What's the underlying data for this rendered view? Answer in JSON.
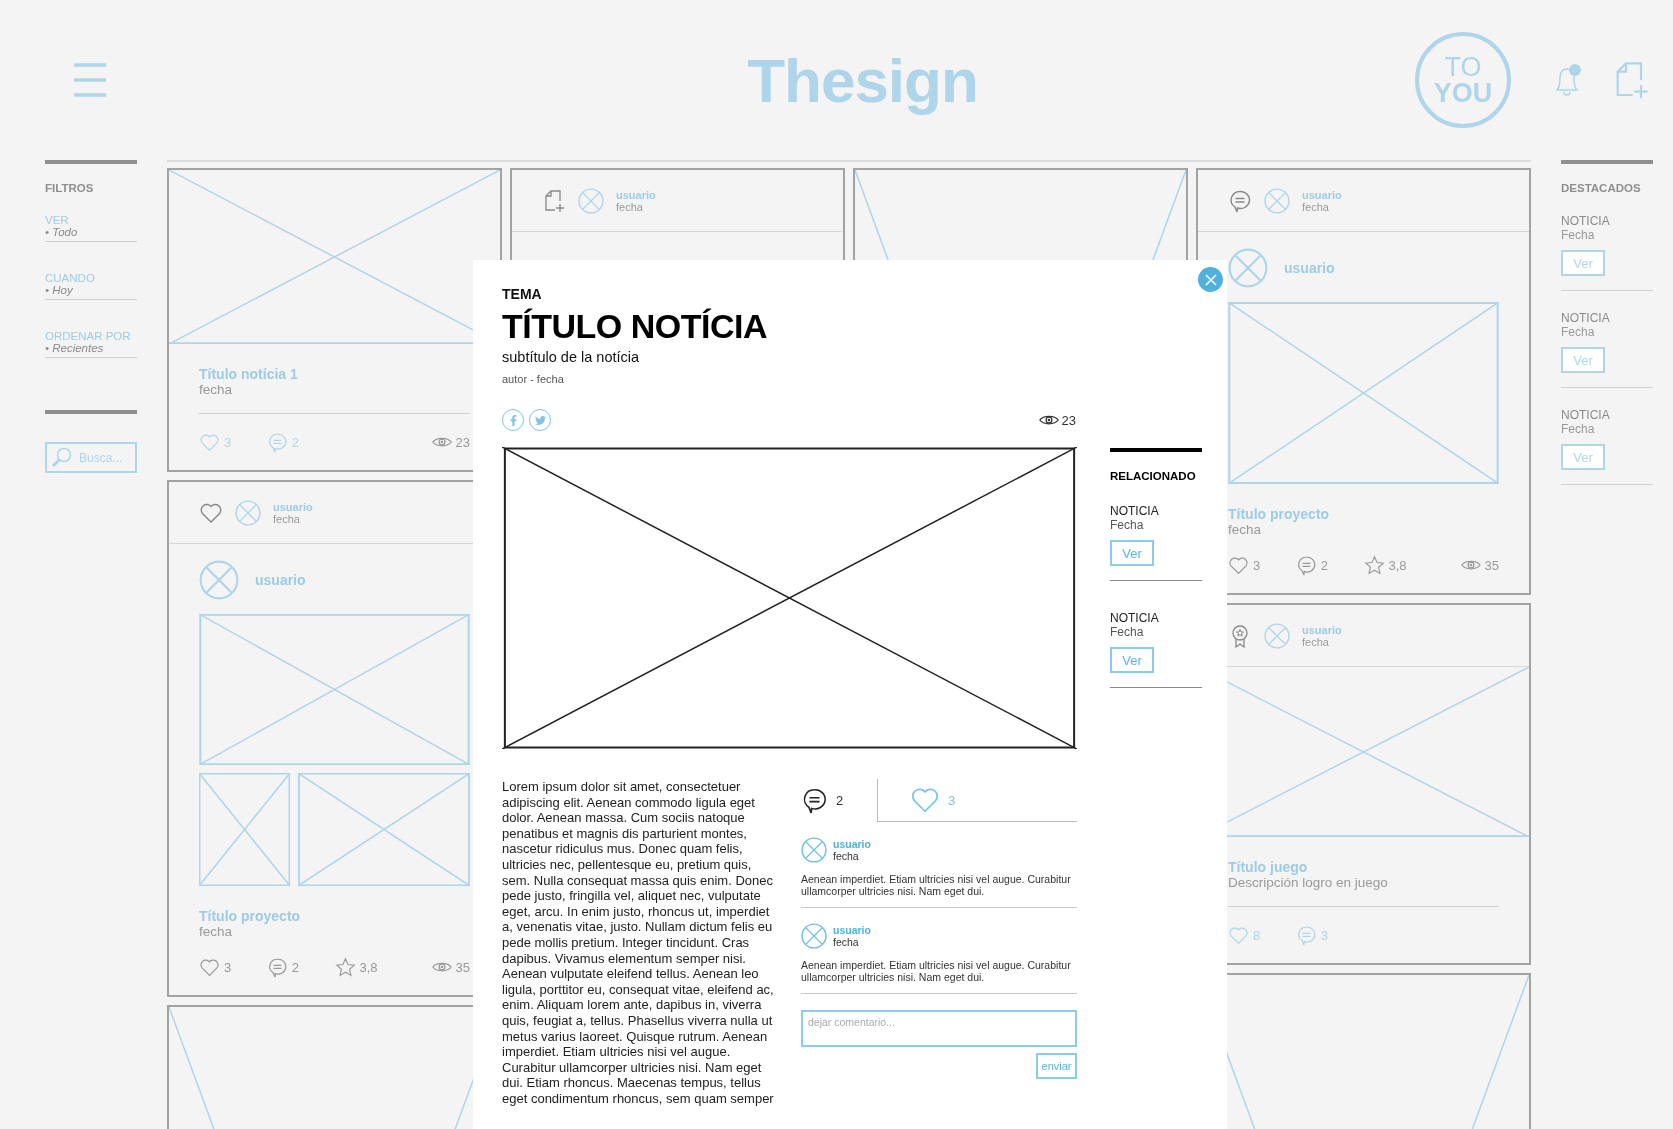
{
  "header": {
    "logo": "Thesign",
    "badge": [
      "TO",
      "YOU"
    ]
  },
  "filters": {
    "title": "FILTROS",
    "groups": [
      {
        "label": "VER",
        "value": "• Todo"
      },
      {
        "label": "CUANDO",
        "value": "• Hoy"
      },
      {
        "label": "ORDENAR POR",
        "value": "• Recientes"
      }
    ],
    "search": {
      "placeholder": "Busca..."
    }
  },
  "feed": {
    "columns": [
      [
        {
          "kind": "news",
          "title": "Título notícia 1",
          "subtitle": "fecha",
          "stats": [
            {
              "kind": "likes",
              "value": "3"
            },
            {
              "kind": "comments",
              "value": "2"
            },
            {
              "kind": "views",
              "value": "23"
            }
          ]
        },
        {
          "kind": "post",
          "header": {
            "kind": "like",
            "user": "usuario",
            "date": "fecha"
          },
          "author": "usuario",
          "media": {
            "kind": "gallery"
          },
          "title": "Título proyecto",
          "subtitle": "fecha",
          "stats": [
            {
              "kind": "likes",
              "value": "3"
            },
            {
              "kind": "comments",
              "value": "2"
            },
            {
              "kind": "rating",
              "value": "3,8"
            },
            {
              "kind": "views",
              "value": "35"
            }
          ]
        },
        {
          "kind": "image"
        }
      ],
      [
        {
          "kind": "post",
          "header": {
            "kind": "create",
            "user": "usuario",
            "date": "fecha"
          }
        }
      ],
      [
        {
          "kind": "image"
        }
      ],
      [
        {
          "kind": "post",
          "header": {
            "kind": "comment",
            "user": "usuario",
            "date": "fecha"
          },
          "author": "usuario",
          "media": {
            "kind": "single"
          },
          "title": "Título proyecto",
          "subtitle": "fecha",
          "stats": [
            {
              "kind": "likes",
              "value": "3"
            },
            {
              "kind": "comments",
              "value": "2"
            },
            {
              "kind": "rating",
              "value": "3,8"
            },
            {
              "kind": "views",
              "value": "35"
            }
          ]
        },
        {
          "kind": "game",
          "header": {
            "kind": "achievement",
            "user": "usuario",
            "date": "fecha"
          },
          "title": "Título juego",
          "subtitle": "Descripción logro en juego",
          "stats": [
            {
              "kind": "likes",
              "value": "8"
            },
            {
              "kind": "comments",
              "value": "3"
            }
          ]
        },
        {
          "kind": "image"
        }
      ]
    ]
  },
  "featured": {
    "title": "DESTACADOS",
    "items": [
      {
        "title": "NOTICIA",
        "date": "Fecha",
        "action": "Ver"
      },
      {
        "title": "NOTICIA",
        "date": "Fecha",
        "action": "Ver"
      },
      {
        "title": "NOTICIA",
        "date": "Fecha",
        "action": "Ver"
      }
    ]
  },
  "modal": {
    "topic": "TEMA",
    "title": "TÍTULO NOTÍCIA",
    "subtitle": "subtítulo de la notícia",
    "byline": "autor - fecha",
    "views": "23",
    "body": "Lorem ipsum dolor sit amet, consectetuer adipiscing elit. Aenean commodo ligula eget dolor. Aenean massa. Cum sociis natoque penatibus et magnis dis parturient montes, nascetur ridiculus mus. Donec quam felis, ultricies nec, pellentesque eu, pretium quis, sem. Nulla consequat massa quis enim. Donec pede justo, fringilla vel, aliquet nec, vulputate eget, arcu. In enim justo, rhoncus ut, imperdiet a, venenatis vitae, justo. Nullam dictum felis eu pede mollis pretium. Integer tincidunt. Cras dapibus. Vivamus elementum semper nisi. Aenean vulputate eleifend tellus. Aenean leo ligula, porttitor eu, consequat vitae, eleifend ac, enim. Aliquam lorem ante, dapibus in, viverra quis, feugiat a, tellus. Phasellus viverra nulla ut metus varius laoreet. Quisque rutrum. Aenean imperdiet. Etiam ultricies nisi vel augue. Curabitur ullamcorper ultricies nisi. Nam eget dui. Etiam rhoncus. Maecenas tempus, tellus eget condimentum rhoncus, sem quam semper",
    "tabs": [
      {
        "kind": "comments",
        "count": "2",
        "selected": true
      },
      {
        "kind": "likes",
        "count": "3",
        "selected": false
      }
    ],
    "comments": [
      {
        "user": "usuario",
        "date": "fecha",
        "text": "Aenean imperdiet. Etiam ultricies nisi vel augue. Curabitur ullamcorper ultricies nisi. Nam eget dui."
      },
      {
        "user": "usuario",
        "date": "fecha",
        "text": "Aenean imperdiet. Etiam ultricies nisi vel augue. Curabitur ullamcorper ultricies nisi. Nam eget dui."
      }
    ],
    "comment_field": {
      "placeholder": "dejar comentario..."
    },
    "send": "enviar",
    "related": {
      "title": "RELACIONADO",
      "items": [
        {
          "title": "NOTICIA",
          "date": "Fecha",
          "action": "Ver"
        },
        {
          "title": "NOTICIA",
          "date": "Fecha",
          "action": "Ver"
        }
      ]
    }
  }
}
